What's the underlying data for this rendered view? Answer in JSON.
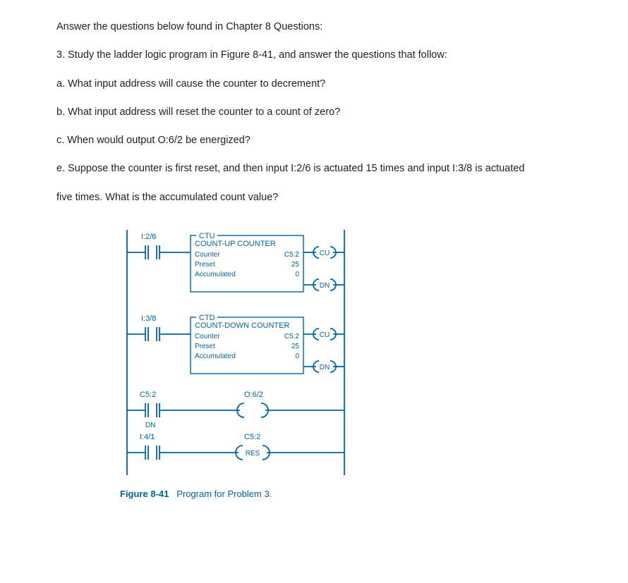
{
  "intro": "Answer the questions below found in Chapter 8 Questions:",
  "q3": "3. Study the ladder logic program in Figure 8-41, and answer the questions that follow:",
  "qa": "a. What input address will cause the counter to decrement?",
  "qb": "b. What input address will reset the counter to a count of zero?",
  "qc": "c. When would output O:6/2 be energized?",
  "qe": "e. Suppose the counter is first reset, and then input I:2/6 is actuated 15 times and input I:3/8 is actuated",
  "qe2": "five times. What is the accumulated count value?",
  "diagram": {
    "rung1": {
      "input": "I:2/6",
      "block": {
        "type": "CTU",
        "title": "COUNT-UP COUNTER",
        "rows": [
          {
            "label": "Counter",
            "value": "C5:2"
          },
          {
            "label": "Preset",
            "value": "25"
          },
          {
            "label": "Accumulated",
            "value": "0"
          }
        ]
      },
      "outputs": [
        "CU",
        "DN"
      ]
    },
    "rung2": {
      "input": "I:3/8",
      "block": {
        "type": "CTD",
        "title": "COUNT-DOWN COUNTER",
        "rows": [
          {
            "label": "Counter",
            "value": "C5:2"
          },
          {
            "label": "Preset",
            "value": "25"
          },
          {
            "label": "Accumulated",
            "value": "0"
          }
        ]
      },
      "outputs": [
        "CU",
        "DN"
      ]
    },
    "rung3": {
      "input": "C5:2",
      "input_sub": "DN",
      "output": "O:6/2"
    },
    "rung4": {
      "input": "I:4/1",
      "output": "C5:2",
      "output_sym": "RES"
    }
  },
  "caption_bold": "Figure 8-41",
  "caption_text": "Program for Problem 3.",
  "chart_data": {
    "type": "diagram",
    "description": "PLC ladder logic diagram with 4 rungs",
    "rungs": [
      {
        "n": 1,
        "input": "I:2/6 (XIC)",
        "instruction": "CTU C5:2 Preset=25 Acc=0",
        "outputs": [
          "CU",
          "DN"
        ]
      },
      {
        "n": 2,
        "input": "I:3/8 (XIC)",
        "instruction": "CTD C5:2 Preset=25 Acc=0",
        "outputs": [
          "CU",
          "DN"
        ]
      },
      {
        "n": 3,
        "input": "C5:2/DN (XIC)",
        "instruction": "OTE O:6/2"
      },
      {
        "n": 4,
        "input": "I:4/1 (XIC)",
        "instruction": "RES C5:2"
      }
    ]
  }
}
